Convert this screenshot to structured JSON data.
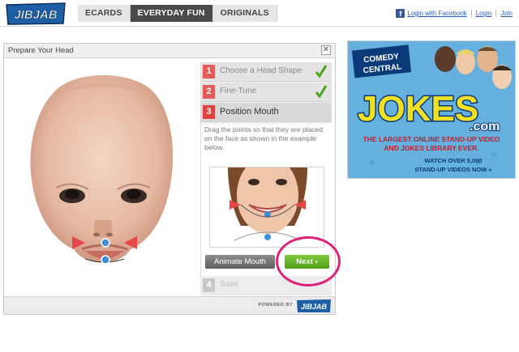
{
  "nav": {
    "logo_text": "JIBJAB",
    "tabs": [
      {
        "label": "ECARDS",
        "active": false
      },
      {
        "label": "EVERYDAY FUN",
        "active": true
      },
      {
        "label": "ORIGINALS",
        "active": false
      }
    ],
    "facebook_login": "Login with Facebook",
    "login": "Login",
    "join": "Join"
  },
  "panel": {
    "title": "Prepare Your Head",
    "close_glyph": "✕",
    "steps": [
      {
        "number": "1",
        "label": "Choose a Head Shape",
        "state": "done"
      },
      {
        "number": "2",
        "label": "Fine-Tune",
        "state": "done"
      },
      {
        "number": "3",
        "label": "Position Mouth",
        "state": "active"
      },
      {
        "number": "4",
        "label": "Save",
        "state": "disabled"
      }
    ],
    "instructions": "Drag the points so that they are placed on the face as shown in the example below.",
    "animate_button": "Animate Mouth",
    "next_button": "Next",
    "powered_by": "POWERED BY",
    "footer_logo_text": "JIBJAB"
  },
  "ad": {
    "brand": "COMEDY CENTRAL",
    "headline": "JOKES",
    "domain": ".com",
    "tagline": "THE LARGEST ONLINE STAND-UP VIDEO AND JOKES LIBRARY EVER.",
    "cta_line1": "WATCH OVER 5,000",
    "cta_line2": "STAND-UP VIDEOS NOW",
    "cta_arrows": "»"
  },
  "colors": {
    "accent": "#e0207a",
    "step_red": "#e45b5b",
    "step_active_red": "#e04141",
    "check_green": "#4aa51c",
    "next_green": "#5fb328",
    "tab_active": "#4a4a4a",
    "handle_blue": "#3c8fd8",
    "marker_red": "#e84545"
  }
}
